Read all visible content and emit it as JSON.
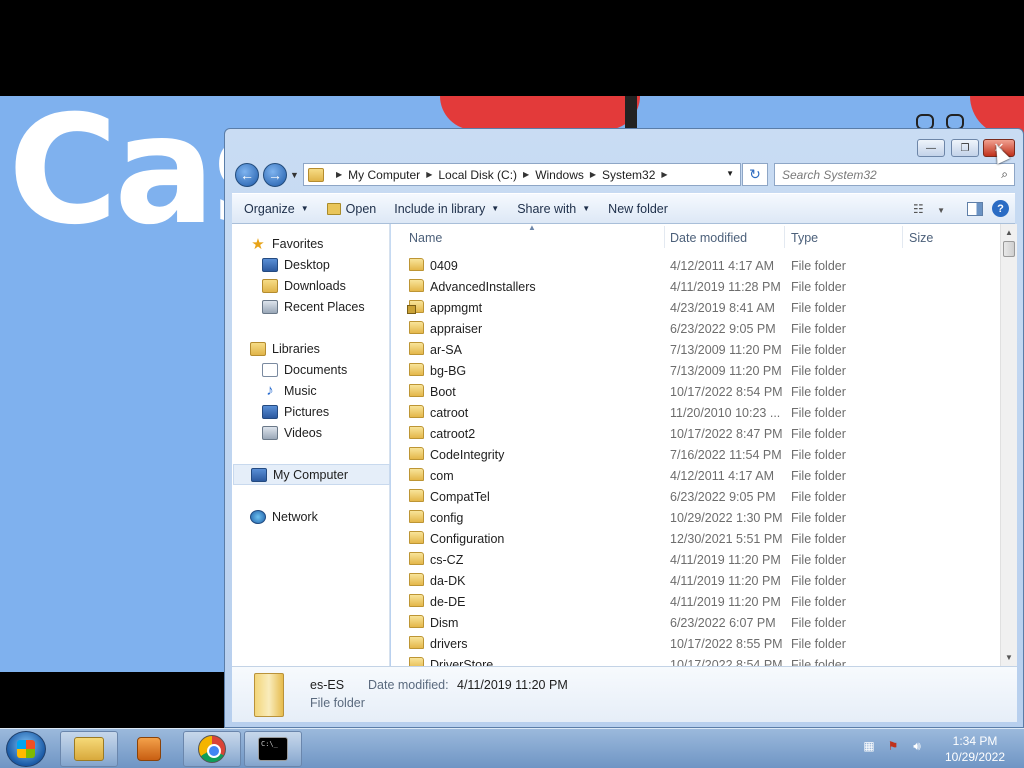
{
  "wallpaper": {
    "text": "Cas"
  },
  "window": {
    "caption": {
      "minimize": "—",
      "maximize": "❐",
      "close": "✕"
    }
  },
  "address": {
    "back": "←",
    "forward": "→",
    "breadcrumbs": [
      "My Computer",
      "Local Disk (C:)",
      "Windows",
      "System32"
    ],
    "refresh": "↻",
    "search_placeholder": "Search System32",
    "search_icon": "⌕"
  },
  "commands": {
    "organize": "Organize",
    "open": "Open",
    "include_in_library": "Include in library",
    "share_with": "Share with",
    "new_folder": "New folder",
    "help": "?"
  },
  "nav": {
    "favorites": "Favorites",
    "desktop": "Desktop",
    "downloads": "Downloads",
    "recent_places": "Recent Places",
    "libraries": "Libraries",
    "documents": "Documents",
    "music": "Music",
    "pictures": "Pictures",
    "videos": "Videos",
    "my_computer": "My Computer",
    "network": "Network"
  },
  "columns": {
    "name": "Name",
    "date_modified": "Date modified",
    "type": "Type",
    "size": "Size"
  },
  "files": [
    {
      "name": "0409",
      "date": "4/12/2011 4:17 AM",
      "type": "File folder"
    },
    {
      "name": "AdvancedInstallers",
      "date": "4/11/2019 11:28 PM",
      "type": "File folder"
    },
    {
      "name": "appmgmt",
      "date": "4/23/2019 8:41 AM",
      "type": "File folder",
      "locked": true
    },
    {
      "name": "appraiser",
      "date": "6/23/2022 9:05 PM",
      "type": "File folder"
    },
    {
      "name": "ar-SA",
      "date": "7/13/2009 11:20 PM",
      "type": "File folder"
    },
    {
      "name": "bg-BG",
      "date": "7/13/2009 11:20 PM",
      "type": "File folder"
    },
    {
      "name": "Boot",
      "date": "10/17/2022 8:54 PM",
      "type": "File folder"
    },
    {
      "name": "catroot",
      "date": "11/20/2010 10:23 ...",
      "type": "File folder"
    },
    {
      "name": "catroot2",
      "date": "10/17/2022 8:47 PM",
      "type": "File folder"
    },
    {
      "name": "CodeIntegrity",
      "date": "7/16/2022 11:54 PM",
      "type": "File folder"
    },
    {
      "name": "com",
      "date": "4/12/2011 4:17 AM",
      "type": "File folder"
    },
    {
      "name": "CompatTel",
      "date": "6/23/2022 9:05 PM",
      "type": "File folder"
    },
    {
      "name": "config",
      "date": "10/29/2022 1:30 PM",
      "type": "File folder"
    },
    {
      "name": "Configuration",
      "date": "12/30/2021 5:51 PM",
      "type": "File folder"
    },
    {
      "name": "cs-CZ",
      "date": "4/11/2019 11:20 PM",
      "type": "File folder"
    },
    {
      "name": "da-DK",
      "date": "4/11/2019 11:20 PM",
      "type": "File folder"
    },
    {
      "name": "de-DE",
      "date": "4/11/2019 11:20 PM",
      "type": "File folder"
    },
    {
      "name": "Dism",
      "date": "6/23/2022 6:07 PM",
      "type": "File folder"
    },
    {
      "name": "drivers",
      "date": "10/17/2022 8:55 PM",
      "type": "File folder"
    },
    {
      "name": "DriverStore",
      "date": "10/17/2022 8:54 PM",
      "type": "File folder"
    }
  ],
  "details": {
    "name": "es-ES",
    "date_label": "Date modified:",
    "date": "4/11/2019 11:20 PM",
    "type": "File folder"
  },
  "taskbar": {
    "cmd_glyph": "C:\\_",
    "time": "1:34 PM",
    "date": "10/29/2022"
  }
}
